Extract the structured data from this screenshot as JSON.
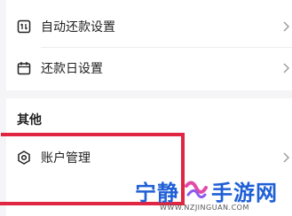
{
  "settings": {
    "items": [
      {
        "label": "自动还款设置",
        "icon": "auto-repay-icon"
      },
      {
        "label": "还款日设置",
        "icon": "calendar-icon"
      }
    ]
  },
  "other": {
    "title": "其他",
    "items": [
      {
        "label": "账户管理",
        "icon": "hexagon-settings-icon"
      }
    ]
  },
  "watermark": {
    "left": "宁静",
    "right": "手游网",
    "url": "WWW.NZJINGUAN.COM"
  },
  "colors": {
    "highlight": "#e02640",
    "watermark": "#1f5fd6"
  }
}
